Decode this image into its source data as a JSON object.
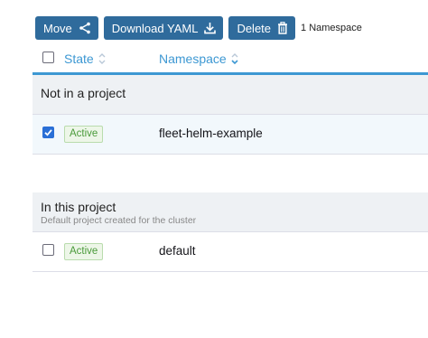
{
  "toolbar": {
    "move_label": "Move",
    "download_label": "Download YAML",
    "delete_label": "Delete",
    "selection_count": "1 Namespace"
  },
  "table": {
    "headers": {
      "state": "State",
      "namespace": "Namespace"
    },
    "groups": [
      {
        "title": "Not in a project",
        "subtitle": "",
        "rows": [
          {
            "checked": true,
            "state": "Active",
            "namespace": "fleet-helm-example"
          }
        ]
      },
      {
        "title": "In this project",
        "subtitle": "Default project created for the cluster",
        "rows": [
          {
            "checked": false,
            "state": "Active",
            "namespace": "default"
          }
        ]
      }
    ]
  },
  "colors": {
    "button_bg": "#2f6b9c",
    "accent": "#3d98d3",
    "checkbox_checked": "#2a6fd6",
    "active_badge_text": "#4a9a3a",
    "active_badge_bg": "#edf6e8"
  },
  "icons": {
    "move": "share-icon",
    "download": "download-icon",
    "delete": "trash-icon",
    "sort": "sort-icon"
  }
}
